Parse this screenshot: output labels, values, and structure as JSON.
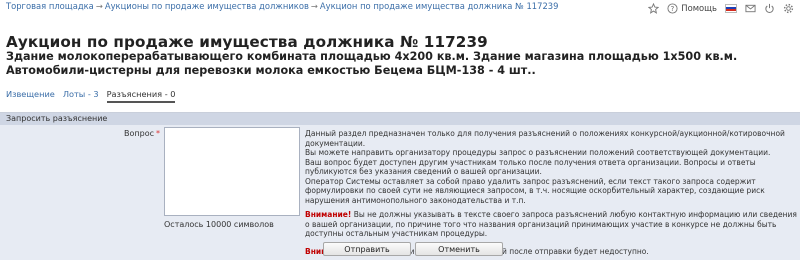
{
  "breadcrumb": {
    "items": [
      "Торговая площадка",
      "Аукционы по продаже имущества должников",
      "Аукцион по продаже имущества должника № 117239"
    ],
    "separator": "→"
  },
  "toolbar": {
    "help_label": "Помощь",
    "icons": [
      "star-icon",
      "question-icon",
      "flag-ru-icon",
      "mail-icon",
      "power-icon",
      "gear-icon"
    ],
    "flag_colors": [
      "#ffffff",
      "#1c3fb6",
      "#d52b1e"
    ]
  },
  "page": {
    "title": "Аукцион по продаже имущества должника № 117239",
    "subtitle": "Здание молокоперерабатывающего комбината площадью 4х200 кв.м. Здание магазина площадью 1х500 кв.м. Автомобили-цистерны для перевозки молока емкостью Бецема БЦМ-138 - 4 шт.."
  },
  "tabs": [
    {
      "label": "Извещение",
      "active": false
    },
    {
      "label": "Лоты - 3",
      "active": false
    },
    {
      "label": "Разъяснения - 0",
      "active": true
    }
  ],
  "form": {
    "section_title": "Запросить разъяснение",
    "question_label": "Вопрос",
    "required_mark": "*",
    "question_value": "",
    "counter_text": "Осталось 10000 символов",
    "info": {
      "line1": "Данный раздел предназначен только для получения разъяснений о положениях конкурсной/аукционной/котировочной документации.",
      "line2": "Вы можете направить организатору процедуры запрос о разъяснении положений соответствующей документации.",
      "line3": "Ваш вопрос будет доступен другим участникам только после получения ответа организации. Вопросы и ответы публикуются без указания сведений о вашей организации.",
      "line4": "Оператор Системы оставляет за собой право удалить запрос разъяснений, если текст такого запроса содержит формулировки по своей сути не являющиеся запросом, в т.ч. носящие оскорбительный характер, создающие риск нарушения антимонопольного законодательства и т.п.",
      "warning_label": "Внимание!",
      "warning1": "Вы не должны указывать в тексте своего запроса разъяснений любую контактную информацию или сведения о вашей организации, по причине того что названия организаций принимающих участие в конкурсе не должны быть доступны остальным участникам процедуры.",
      "warning2": "Редактирование запроса разъяснений после отправки будет недоступно."
    },
    "submit_label": "Отправить",
    "cancel_label": "Отменить"
  }
}
